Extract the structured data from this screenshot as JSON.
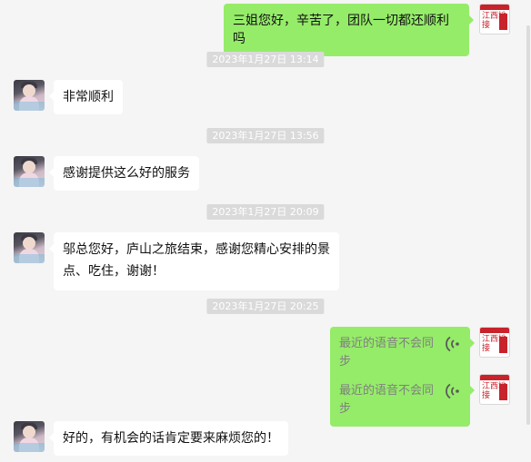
{
  "messages": [
    {
      "sender": "self",
      "type": "text",
      "text": "三姐您好，辛苦了，团队一切都还顺利吗"
    },
    {
      "type": "time",
      "text": "2023年1月27日 13:14"
    },
    {
      "sender": "friend",
      "type": "text",
      "text": "非常顺利"
    },
    {
      "type": "time",
      "text": "2023年1月27日 13:56"
    },
    {
      "sender": "friend",
      "type": "text",
      "text": "感谢提供这么好的服务"
    },
    {
      "type": "time",
      "text": "2023年1月27日 20:09"
    },
    {
      "sender": "friend",
      "type": "text",
      "line1": "邬总您好，庐山之旅结束，感谢您精心安排的景",
      "line2": "点、吃住，谢谢！"
    },
    {
      "type": "time",
      "text": "2023年1月27日 20:25"
    },
    {
      "sender": "self",
      "type": "voice",
      "text": "最近的语音不会同步",
      "icon": "voice-wave-icon"
    },
    {
      "sender": "self",
      "type": "voice",
      "text": "最近的语音不会同步",
      "icon": "voice-wave-icon"
    },
    {
      "sender": "friend",
      "type": "text",
      "text": "好的，有机会的话肯定要来麻烦您的！"
    }
  ],
  "self_avatar": {
    "text": "江西地接"
  },
  "colors": {
    "background": "#f5f5f5",
    "outgoing": "#95ec69",
    "incoming": "#ffffff",
    "timestamp": "#dadada",
    "brand_red": "#c8222b"
  }
}
